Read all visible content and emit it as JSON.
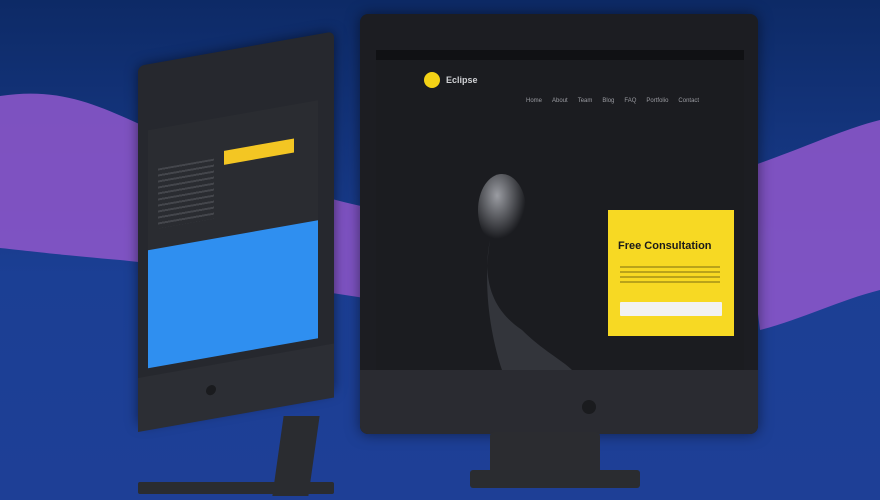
{
  "scene": {
    "background_colors": [
      "#0d2a66",
      "#1e3f96"
    ],
    "wave_color": "#8a55c8"
  },
  "left_monitor": {
    "accent_blue": "#2f8ff0",
    "accent_yellow": "#f3c623",
    "icons": [
      "service-icon",
      "service-icon",
      "service-icon",
      "plus-icon"
    ]
  },
  "right_monitor": {
    "brand": {
      "logo_icon": "brand-logo-icon",
      "name": "Eclipse"
    },
    "nav_items": [
      "Home",
      "About",
      "Team",
      "Blog",
      "FAQ",
      "Portfolio",
      "Contact"
    ],
    "cta": {
      "title": "Free Consultation",
      "color": "#f7d923"
    }
  }
}
